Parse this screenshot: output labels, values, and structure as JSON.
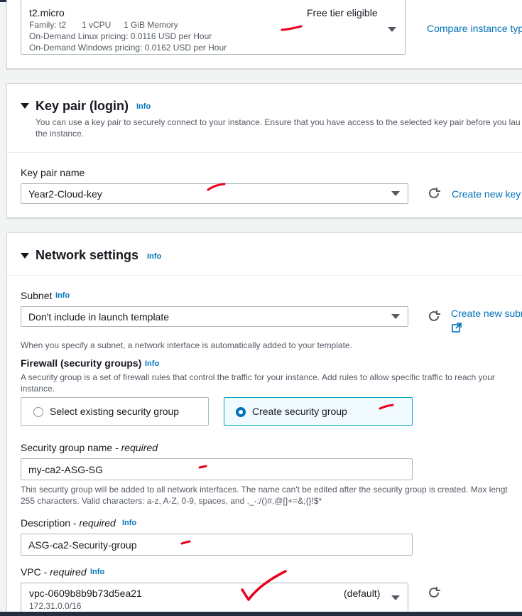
{
  "instance_type": {
    "name": "t2.micro",
    "family": "Family: t2",
    "vcpu": "1 vCPU",
    "memory": "1 GiB Memory",
    "linux_pricing": "On-Demand Linux pricing: 0.0116 USD per Hour",
    "windows_pricing": "On-Demand Windows pricing: 0.0162 USD per Hour",
    "badge": "Free tier eligible",
    "compare_link": "Compare instance typ"
  },
  "key_pair": {
    "title": "Key pair (login)",
    "info": "Info",
    "description_line1": "You can use a key pair to securely connect to your instance. Ensure that you have access to the selected key pair before you lau",
    "description_line2": "the instance.",
    "field_label": "Key pair name",
    "selected": "Year2-Cloud-key",
    "create_link": "Create new key"
  },
  "network": {
    "title": "Network settings",
    "info": "Info",
    "subnet": {
      "label": "Subnet",
      "info": "Info",
      "selected": "Don't include in launch template",
      "create_link": "Create new subn",
      "hint": "When you specify a subnet, a network interface is automatically added to your template."
    },
    "firewall": {
      "label": "Firewall (security groups)",
      "info": "Info",
      "description_line1": "A security group is a set of firewall rules that control the traffic for your instance. Add rules to allow specific traffic to reach your",
      "description_line2": "instance.",
      "option_existing": "Select existing security group",
      "option_create": "Create security group",
      "selected_option": "create"
    },
    "sg_name": {
      "label": "Security group name - ",
      "required": "required",
      "value": "my-ca2-ASG-SG",
      "hint_line1": "This security group will be added to all network interfaces. The name can't be edited after the security group is created. Max lengt",
      "hint_line2": "255 characters. Valid characters: a-z, A-Z, 0-9, spaces, and ._-:/()#,@[]+=&;{}!$*"
    },
    "description": {
      "label": "Description - ",
      "required": "required",
      "info": "Info",
      "value": "ASG-ca2-Security-group"
    },
    "vpc": {
      "label": "VPC - ",
      "required": "required",
      "info": "Info",
      "value": "vpc-0609b8b9b73d5ea21",
      "cidr": "172.31.0.0/16",
      "tag": "(default)"
    }
  },
  "colors": {
    "link": "#0073bb",
    "annotation": "#e8001c",
    "selected_border": "#00a1c9"
  },
  "icons": [
    "caret-down-icon",
    "refresh-icon",
    "external-link-icon",
    "triangle-expanded-icon",
    "radio-icon"
  ]
}
